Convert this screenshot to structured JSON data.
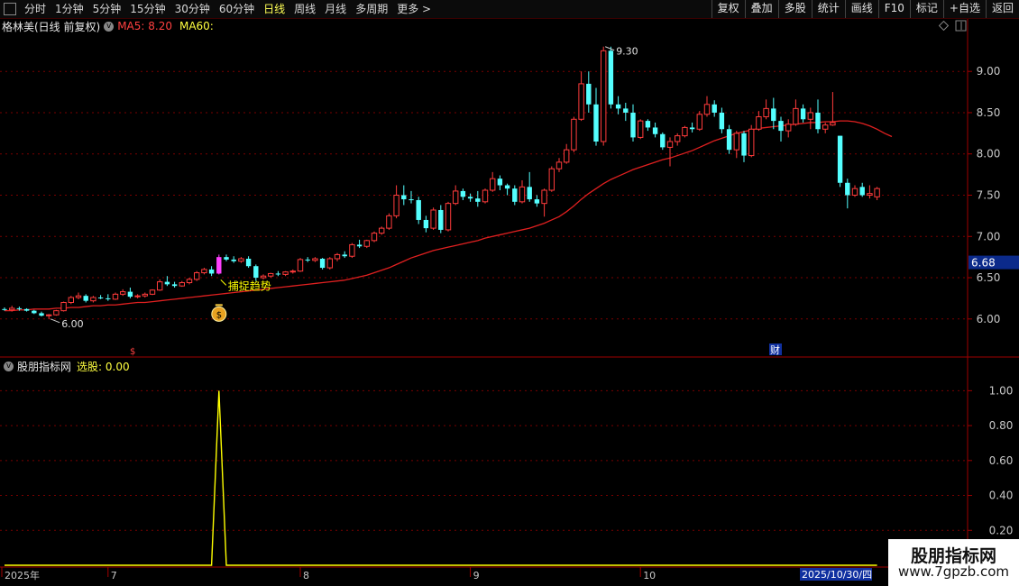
{
  "toolbar": {
    "periods": [
      "分时",
      "1分钟",
      "5分钟",
      "15分钟",
      "30分钟",
      "60分钟",
      "日线",
      "周线",
      "月线",
      "多周期",
      "更多 >"
    ],
    "active_period": "日线",
    "right_buttons": [
      "复权",
      "叠加",
      "多股",
      "统计",
      "画线",
      "F10",
      "标记",
      "+自选",
      "返回"
    ]
  },
  "main_chart": {
    "title": "格林美(日线 前复权)",
    "ma5_label": "MA5: 8.20",
    "ma60_label": "MA60:",
    "price_axis": [
      "9.00",
      "8.50",
      "8.00",
      "7.50",
      "7.00",
      "6.50",
      "6.00"
    ],
    "current_price": "6.68",
    "high_label": "9.30",
    "low_label": "6.00",
    "signal_text": "捕捉趋势",
    "event_marker_1": "$",
    "event_marker_2": "财"
  },
  "indicator_panel": {
    "title": "股朋指标网",
    "value_label": "选股: 0.00",
    "axis": [
      "1.00",
      "0.80",
      "0.60",
      "0.40",
      "0.20"
    ]
  },
  "date_axis": {
    "labels": [
      "2025年",
      "7",
      "8",
      "9",
      "10"
    ],
    "cursor_date": "2025/10/30/四"
  },
  "watermark": {
    "line1": "股朋指标网",
    "line2": "www.7gpzb.com"
  },
  "colors": {
    "up": "#ff3b3b",
    "down": "#54ffff",
    "ma60": "#e02020",
    "signal": "#ffff00",
    "highlight": "#ff40ff",
    "grid": "#7a0000"
  },
  "chart_data": {
    "type": "candlestick",
    "ylim": [
      5.55,
      9.45
    ],
    "indicator_ylim": [
      0,
      1.1
    ],
    "candles": [
      [
        6.12,
        6.14,
        6.1,
        6.11
      ],
      [
        6.11,
        6.16,
        6.09,
        6.13
      ],
      [
        6.13,
        6.15,
        6.1,
        6.12
      ],
      [
        6.12,
        6.13,
        6.09,
        6.1
      ],
      [
        6.1,
        6.11,
        6.06,
        6.07
      ],
      [
        6.07,
        6.09,
        6.03,
        6.04
      ],
      [
        6.04,
        6.06,
        6.0,
        6.05
      ],
      [
        6.05,
        6.11,
        6.04,
        6.1
      ],
      [
        6.1,
        6.21,
        6.09,
        6.2
      ],
      [
        6.2,
        6.28,
        6.18,
        6.26
      ],
      [
        6.26,
        6.32,
        6.24,
        6.28
      ],
      [
        6.28,
        6.3,
        6.2,
        6.22
      ],
      [
        6.22,
        6.28,
        6.2,
        6.26
      ],
      [
        6.26,
        6.29,
        6.24,
        6.25
      ],
      [
        6.25,
        6.3,
        6.22,
        6.24
      ],
      [
        6.24,
        6.32,
        6.23,
        6.3
      ],
      [
        6.3,
        6.36,
        6.28,
        6.33
      ],
      [
        6.33,
        6.38,
        6.25,
        6.27
      ],
      [
        6.27,
        6.3,
        6.25,
        6.28
      ],
      [
        6.28,
        6.32,
        6.26,
        6.3
      ],
      [
        6.3,
        6.36,
        6.29,
        6.35
      ],
      [
        6.35,
        6.48,
        6.34,
        6.45
      ],
      [
        6.45,
        6.52,
        6.4,
        6.42
      ],
      [
        6.42,
        6.45,
        6.38,
        6.4
      ],
      [
        6.4,
        6.46,
        6.39,
        6.44
      ],
      [
        6.44,
        6.5,
        6.42,
        6.48
      ],
      [
        6.48,
        6.58,
        6.46,
        6.56
      ],
      [
        6.56,
        6.62,
        6.54,
        6.6
      ],
      [
        6.6,
        6.64,
        6.52,
        6.55
      ],
      [
        6.55,
        6.78,
        6.54,
        6.75
      ],
      [
        6.75,
        6.78,
        6.7,
        6.72
      ],
      [
        6.72,
        6.76,
        6.68,
        6.7
      ],
      [
        6.7,
        6.75,
        6.68,
        6.73
      ],
      [
        6.73,
        6.76,
        6.62,
        6.64
      ],
      [
        6.64,
        6.66,
        6.46,
        6.5
      ],
      [
        6.5,
        6.54,
        6.48,
        6.52
      ],
      [
        6.52,
        6.56,
        6.5,
        6.55
      ],
      [
        6.55,
        6.58,
        6.52,
        6.54
      ],
      [
        6.54,
        6.58,
        6.52,
        6.57
      ],
      [
        6.57,
        6.6,
        6.55,
        6.58
      ],
      [
        6.58,
        6.74,
        6.57,
        6.72
      ],
      [
        6.72,
        6.75,
        6.69,
        6.71
      ],
      [
        6.71,
        6.75,
        6.69,
        6.73
      ],
      [
        6.73,
        6.74,
        6.6,
        6.62
      ],
      [
        6.62,
        6.75,
        6.6,
        6.73
      ],
      [
        6.73,
        6.8,
        6.7,
        6.78
      ],
      [
        6.78,
        6.82,
        6.74,
        6.76
      ],
      [
        6.76,
        6.92,
        6.74,
        6.9
      ],
      [
        6.9,
        6.96,
        6.86,
        6.88
      ],
      [
        6.88,
        6.96,
        6.86,
        6.95
      ],
      [
        6.95,
        7.06,
        6.93,
        7.04
      ],
      [
        7.04,
        7.12,
        7.02,
        7.1
      ],
      [
        7.1,
        7.28,
        7.08,
        7.25
      ],
      [
        7.25,
        7.62,
        7.22,
        7.5
      ],
      [
        7.5,
        7.62,
        7.38,
        7.45
      ],
      [
        7.45,
        7.55,
        7.4,
        7.44
      ],
      [
        7.44,
        7.48,
        7.15,
        7.2
      ],
      [
        7.2,
        7.25,
        7.05,
        7.1
      ],
      [
        7.1,
        7.35,
        7.08,
        7.32
      ],
      [
        7.32,
        7.38,
        7.04,
        7.08
      ],
      [
        7.08,
        7.42,
        7.06,
        7.4
      ],
      [
        7.4,
        7.62,
        7.38,
        7.55
      ],
      [
        7.55,
        7.58,
        7.44,
        7.48
      ],
      [
        7.48,
        7.52,
        7.42,
        7.46
      ],
      [
        7.46,
        7.55,
        7.36,
        7.42
      ],
      [
        7.42,
        7.58,
        7.4,
        7.56
      ],
      [
        7.56,
        7.78,
        7.54,
        7.7
      ],
      [
        7.7,
        7.74,
        7.56,
        7.62
      ],
      [
        7.62,
        7.64,
        7.5,
        7.58
      ],
      [
        7.58,
        7.62,
        7.38,
        7.42
      ],
      [
        7.42,
        7.68,
        7.4,
        7.6
      ],
      [
        7.6,
        7.78,
        7.42,
        7.45
      ],
      [
        7.45,
        7.5,
        7.36,
        7.4
      ],
      [
        7.4,
        7.58,
        7.24,
        7.56
      ],
      [
        7.56,
        7.85,
        7.54,
        7.82
      ],
      [
        7.82,
        7.95,
        7.78,
        7.9
      ],
      [
        7.9,
        8.12,
        7.88,
        8.05
      ],
      [
        8.05,
        8.45,
        8.02,
        8.42
      ],
      [
        8.42,
        9.0,
        8.4,
        8.85
      ],
      [
        8.85,
        9.0,
        8.5,
        8.6
      ],
      [
        8.6,
        8.8,
        8.1,
        8.15
      ],
      [
        8.15,
        9.3,
        8.1,
        9.25
      ],
      [
        9.25,
        9.3,
        8.55,
        8.6
      ],
      [
        8.6,
        8.7,
        8.48,
        8.55
      ],
      [
        8.55,
        8.62,
        8.4,
        8.5
      ],
      [
        8.5,
        8.6,
        8.15,
        8.2
      ],
      [
        8.2,
        8.42,
        8.18,
        8.4
      ],
      [
        8.4,
        8.42,
        8.28,
        8.32
      ],
      [
        8.32,
        8.38,
        8.2,
        8.24
      ],
      [
        8.24,
        8.26,
        8.05,
        8.08
      ],
      [
        8.08,
        8.2,
        7.85,
        8.15
      ],
      [
        8.15,
        8.25,
        8.1,
        8.22
      ],
      [
        8.22,
        8.34,
        8.2,
        8.32
      ],
      [
        8.32,
        8.38,
        8.26,
        8.3
      ],
      [
        8.3,
        8.52,
        8.28,
        8.48
      ],
      [
        8.48,
        8.7,
        8.45,
        8.6
      ],
      [
        8.6,
        8.65,
        8.45,
        8.5
      ],
      [
        8.5,
        8.56,
        8.25,
        8.3
      ],
      [
        8.3,
        8.35,
        8.0,
        8.05
      ],
      [
        8.05,
        8.28,
        7.95,
        8.25
      ],
      [
        8.25,
        8.28,
        7.9,
        7.98
      ],
      [
        7.98,
        8.35,
        7.96,
        8.3
      ],
      [
        8.3,
        8.52,
        8.28,
        8.45
      ],
      [
        8.45,
        8.66,
        8.42,
        8.55
      ],
      [
        8.55,
        8.68,
        8.3,
        8.4
      ],
      [
        8.4,
        8.45,
        8.15,
        8.28
      ],
      [
        8.28,
        8.42,
        8.2,
        8.36
      ],
      [
        8.36,
        8.66,
        8.34,
        8.55
      ],
      [
        8.55,
        8.6,
        8.38,
        8.42
      ],
      [
        8.42,
        8.56,
        8.3,
        8.5
      ],
      [
        8.5,
        8.66,
        8.25,
        8.3
      ],
      [
        8.3,
        8.38,
        8.25,
        8.35
      ],
      [
        8.35,
        8.75,
        8.34,
        8.38
      ],
      [
        8.22,
        8.22,
        7.6,
        7.65
      ],
      [
        7.65,
        7.7,
        7.34,
        7.5
      ],
      [
        7.5,
        7.62,
        7.48,
        7.58
      ],
      [
        7.6,
        7.65,
        7.48,
        7.5
      ],
      [
        7.5,
        7.62,
        7.46,
        7.52
      ],
      [
        7.48,
        7.6,
        7.44,
        7.58
      ]
    ],
    "ma60": [
      6.1,
      6.1,
      6.11,
      6.11,
      6.12,
      6.12,
      6.12,
      6.13,
      6.13,
      6.14,
      6.14,
      6.15,
      6.16,
      6.16,
      6.17,
      6.17,
      6.18,
      6.19,
      6.2,
      6.2,
      6.21,
      6.22,
      6.23,
      6.24,
      6.25,
      6.26,
      6.27,
      6.28,
      6.29,
      6.3,
      6.31,
      6.32,
      6.33,
      6.34,
      6.35,
      6.36,
      6.37,
      6.38,
      6.39,
      6.4,
      6.41,
      6.42,
      6.43,
      6.44,
      6.45,
      6.46,
      6.47,
      6.49,
      6.51,
      6.53,
      6.56,
      6.59,
      6.62,
      6.66,
      6.7,
      6.74,
      6.77,
      6.8,
      6.83,
      6.85,
      6.87,
      6.89,
      6.91,
      6.93,
      6.95,
      6.98,
      7.0,
      7.02,
      7.04,
      7.06,
      7.08,
      7.1,
      7.13,
      7.16,
      7.2,
      7.24,
      7.3,
      7.37,
      7.45,
      7.52,
      7.58,
      7.64,
      7.69,
      7.73,
      7.77,
      7.81,
      7.84,
      7.87,
      7.9,
      7.93,
      7.95,
      7.98,
      8.01,
      8.04,
      8.08,
      8.12,
      8.16,
      8.19,
      8.22,
      8.25,
      8.27,
      8.29,
      8.31,
      8.32,
      8.33,
      8.34,
      8.35,
      8.36,
      8.37,
      8.38,
      8.38,
      8.39,
      8.39,
      8.4,
      8.4,
      8.39,
      8.37,
      8.34,
      8.3,
      8.25,
      8.21
    ],
    "signal_index": 29,
    "signal_value": 1.0
  }
}
